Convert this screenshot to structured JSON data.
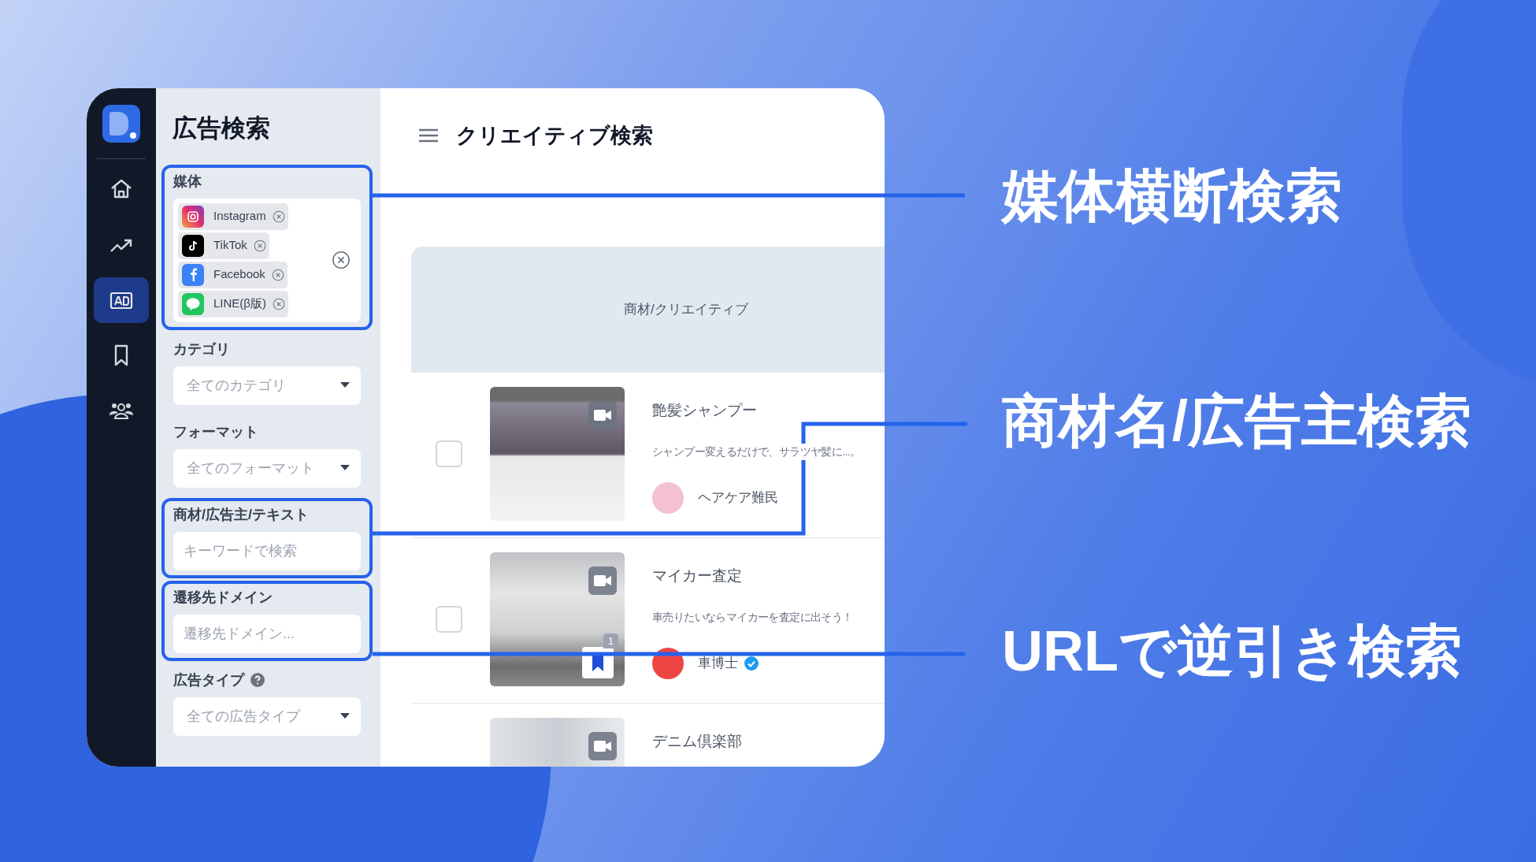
{
  "app": {
    "rail": [
      {
        "selected": false
      },
      {
        "selected": false
      },
      {
        "selected": true
      },
      {
        "selected": false
      },
      {
        "selected": false
      }
    ],
    "panel_title": "広告検索",
    "filters": [
      {
        "kind": "media",
        "label": "媒体",
        "highlighted": true,
        "tags": [
          {
            "name": "Instagram"
          },
          {
            "name": "TikTok"
          },
          {
            "name": "Facebook"
          },
          {
            "name": "LINE(β版)"
          }
        ]
      },
      {
        "kind": "select",
        "label": "カテゴリ",
        "highlighted": false,
        "placeholder": "全てのカテゴリ"
      },
      {
        "kind": "select",
        "label": "フォーマット",
        "highlighted": false,
        "placeholder": "全てのフォーマット"
      },
      {
        "kind": "input",
        "label": "商材/広告主/テキスト",
        "highlighted": true,
        "placeholder": "キーワードで検索"
      },
      {
        "kind": "input",
        "label": "遷移先ドメイン",
        "highlighted": true,
        "placeholder": "遷移先ドメイン..."
      },
      {
        "kind": "select",
        "label": "広告タイプ",
        "highlighted": false,
        "help": true,
        "placeholder": "全ての広告タイプ"
      }
    ],
    "main_title": "クリエイティブ検索",
    "table": {
      "columns": [
        "商材/クリエイティブ"
      ],
      "rows": [
        {
          "checked": false,
          "title": "艶髪シャンプー",
          "description": "シャンプー変えるだけで、サラツヤ髪に...。",
          "advertiser": "ヘアケア難民",
          "verified": false
        },
        {
          "checked": false,
          "title": "マイカー査定",
          "description": "車売りたいならマイカーを査定に出そう！",
          "advertiser": "車博士",
          "verified": true,
          "saved_count": "1"
        },
        {
          "title": "デニム倶楽部"
        }
      ]
    }
  },
  "callouts": [
    "媒体横断検索",
    "商材名/広告主検索",
    "URLで逆引き検索"
  ]
}
